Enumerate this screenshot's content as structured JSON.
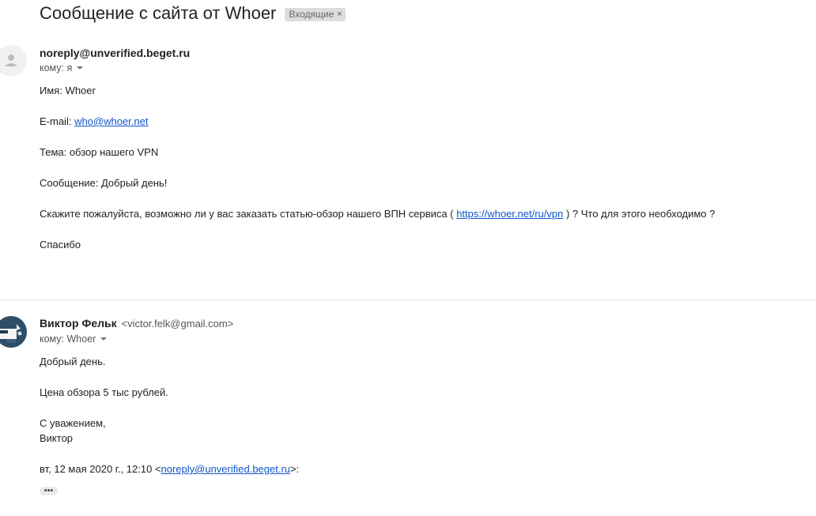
{
  "thread": {
    "subject": "Сообщение с сайта от Whoer",
    "label": "Входящие",
    "label_remove_icon": "×"
  },
  "messages": [
    {
      "avatar": "generic-person-icon",
      "sender_name": "noreply@unverified.beget.ru",
      "to_label": "кому: я",
      "lines": {
        "name": "Имя: Whoer",
        "email_prefix": "E-mail: ",
        "email_link": "who@whoer.net",
        "topic": "Тема: обзор нашего VPN",
        "message": "Сообщение: Добрый день!",
        "request_before": "Скажите пожалуйста, возможно ли у вас заказать статью-обзор нашего ВПН сервиса ( ",
        "request_link": "https://whoer.net/ru/vpn",
        "request_after": " ) ? Что для этого необходимо ?",
        "thanks": "Спасибо"
      }
    },
    {
      "avatar": "photo-avatar",
      "sender_name": "Виктор Фельк",
      "sender_email": "<victor.felk@gmail.com>",
      "to_label": "кому: Whoer",
      "lines": {
        "greeting": "Добрый день.",
        "price": "Цена обзора 5 тыс рублей.",
        "regards": "С уважением,",
        "signature": "Виктор",
        "quote_prefix": "вт, 12 мая 2020 г., 12:10 <",
        "quote_link": "noreply@unverified.beget.ru",
        "quote_suffix": ">:"
      },
      "show_trimmed_label": "•••"
    }
  ],
  "colors": {
    "link": "#1155cc",
    "label_bg": "#dddddd",
    "text": "#222222",
    "muted": "#555555"
  }
}
